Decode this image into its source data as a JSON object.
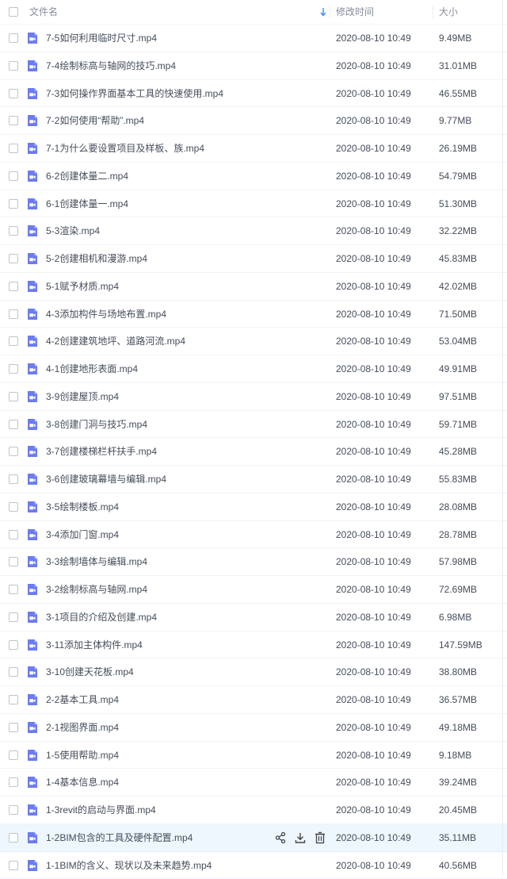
{
  "header": {
    "name_label": "文件名",
    "date_label": "修改时间",
    "size_label": "大小",
    "sort_icon": "arrow-down-icon"
  },
  "colors": {
    "file_icon": "#6c7bf0",
    "hover_row": "#eef6fe",
    "sort_arrow": "#3b8cff",
    "text": "#454d5a",
    "header_text": "#878c9c"
  },
  "hover_row_index": 29,
  "hover_actions": [
    "share-icon",
    "download-icon",
    "delete-icon"
  ],
  "files": [
    {
      "name": "7-5如何利用临时尺寸.mp4",
      "date": "2020-08-10 10:49",
      "size": "9.49MB"
    },
    {
      "name": "7-4绘制标高与轴网的技巧.mp4",
      "date": "2020-08-10 10:49",
      "size": "31.01MB"
    },
    {
      "name": "7-3如何操作界面基本工具的快速使用.mp4",
      "date": "2020-08-10 10:49",
      "size": "46.55MB"
    },
    {
      "name": "7-2如何使用“帮助”.mp4",
      "date": "2020-08-10 10:49",
      "size": "9.77MB"
    },
    {
      "name": "7-1为什么要设置项目及样板、族.mp4",
      "date": "2020-08-10 10:49",
      "size": "26.19MB"
    },
    {
      "name": "6-2创建体量二.mp4",
      "date": "2020-08-10 10:49",
      "size": "54.79MB"
    },
    {
      "name": "6-1创建体量一.mp4",
      "date": "2020-08-10 10:49",
      "size": "51.30MB"
    },
    {
      "name": "5-3渲染.mp4",
      "date": "2020-08-10 10:49",
      "size": "32.22MB"
    },
    {
      "name": "5-2创建相机和漫游.mp4",
      "date": "2020-08-10 10:49",
      "size": "45.83MB"
    },
    {
      "name": "5-1赋予材质.mp4",
      "date": "2020-08-10 10:49",
      "size": "42.02MB"
    },
    {
      "name": "4-3添加构件与场地布置.mp4",
      "date": "2020-08-10 10:49",
      "size": "71.50MB"
    },
    {
      "name": "4-2创建建筑地坪、道路河流.mp4",
      "date": "2020-08-10 10:49",
      "size": "53.04MB"
    },
    {
      "name": "4-1创建地形表面.mp4",
      "date": "2020-08-10 10:49",
      "size": "49.91MB"
    },
    {
      "name": "3-9创建屋顶.mp4",
      "date": "2020-08-10 10:49",
      "size": "97.51MB"
    },
    {
      "name": "3-8创建门洞与技巧.mp4",
      "date": "2020-08-10 10:49",
      "size": "59.71MB"
    },
    {
      "name": "3-7创建楼梯栏杆扶手.mp4",
      "date": "2020-08-10 10:49",
      "size": "45.28MB"
    },
    {
      "name": "3-6创建玻璃幕墙与编辑.mp4",
      "date": "2020-08-10 10:49",
      "size": "55.83MB"
    },
    {
      "name": "3-5绘制楼板.mp4",
      "date": "2020-08-10 10:49",
      "size": "28.08MB"
    },
    {
      "name": "3-4添加门窗.mp4",
      "date": "2020-08-10 10:49",
      "size": "28.78MB"
    },
    {
      "name": "3-3绘制墙体与编辑.mp4",
      "date": "2020-08-10 10:49",
      "size": "57.98MB"
    },
    {
      "name": "3-2绘制标高与轴网.mp4",
      "date": "2020-08-10 10:49",
      "size": "72.69MB"
    },
    {
      "name": "3-1项目的介绍及创建.mp4",
      "date": "2020-08-10 10:49",
      "size": "6.98MB"
    },
    {
      "name": "3-11添加主体构件.mp4",
      "date": "2020-08-10 10:49",
      "size": "147.59MB"
    },
    {
      "name": "3-10创建天花板.mp4",
      "date": "2020-08-10 10:49",
      "size": "38.80MB"
    },
    {
      "name": "2-2基本工具.mp4",
      "date": "2020-08-10 10:49",
      "size": "36.57MB"
    },
    {
      "name": "2-1视图界面.mp4",
      "date": "2020-08-10 10:49",
      "size": "49.18MB"
    },
    {
      "name": "1-5使用帮助.mp4",
      "date": "2020-08-10 10:49",
      "size": "9.18MB"
    },
    {
      "name": "1-4基本信息.mp4",
      "date": "2020-08-10 10:49",
      "size": "39.24MB"
    },
    {
      "name": "1-3revit的启动与界面.mp4",
      "date": "2020-08-10 10:49",
      "size": "20.45MB"
    },
    {
      "name": "1-2BIM包含的工具及硬件配置.mp4",
      "date": "2020-08-10 10:49",
      "size": "35.11MB"
    },
    {
      "name": "1-1BIM的含义、现状以及未来趋势.mp4",
      "date": "2020-08-10 10:49",
      "size": "40.56MB"
    }
  ]
}
